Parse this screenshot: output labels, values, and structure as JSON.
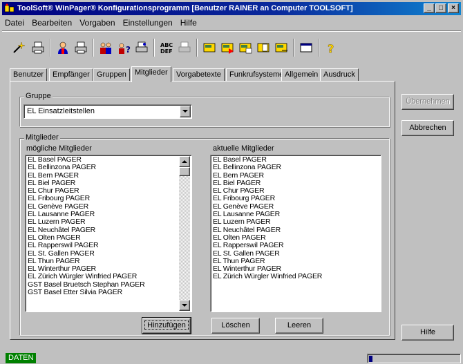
{
  "window": {
    "title": "ToolSoft® WinPager® Konfigurationsprogramm [Benutzer RAINER an Computer TOOLSOFT]",
    "controls": [
      "_",
      "□",
      "×"
    ]
  },
  "menu": [
    "Datei",
    "Bearbeiten",
    "Vorgaben",
    "Einstellungen",
    "Hilfe"
  ],
  "toolbar": {
    "icons": [
      "wand-icon",
      "print-icon",
      "user-icon",
      "print-user-icon",
      "users-icon",
      "user-question-icon",
      "print-users-icon",
      "abc-def-icon",
      "print-text-icon",
      "pager-icon",
      "pager-red-icon",
      "pager-send-icon",
      "pager-open-icon",
      "pager-list-icon",
      "window-icon",
      "help-icon"
    ]
  },
  "tabs": [
    "Benutzer",
    "Empfänger",
    "Gruppen",
    "Mitglieder",
    "Vorgabetexte",
    "Funkrufsysteme",
    "Allgemein",
    "Ausdruck"
  ],
  "active_tab": "Mitglieder",
  "gruppe": {
    "label": "Gruppe",
    "selected": "EL Einsatzleitstellen"
  },
  "mitglieder": {
    "label": "Mitglieder",
    "possible_label": "mögliche Mitglieder",
    "current_label": "aktuelle Mitglieder",
    "possible": [
      "EL Basel PAGER",
      "EL Bellinzona PAGER",
      "EL Bern PAGER",
      "EL Biel PAGER",
      "EL Chur PAGER",
      "EL Fribourg PAGER",
      "EL Genève PAGER",
      "EL Lausanne PAGER",
      "EL Luzern PAGER",
      "EL Neuchâtel PAGER",
      "EL Olten PAGER",
      "EL Rapperswil PAGER",
      "EL St. Gallen PAGER",
      "EL Thun PAGER",
      "EL Winterthur PAGER",
      "EL Zürich Würgler Winfried PAGER",
      "GST Basel Bruetsch Stephan PAGER",
      "GST Basel Etter Silvia PAGER"
    ],
    "current": [
      "EL Basel PAGER",
      "EL Bellinzona PAGER",
      "EL Bern PAGER",
      "EL Biel PAGER",
      "EL Chur PAGER",
      "EL Fribourg PAGER",
      "EL Genève PAGER",
      "EL Lausanne PAGER",
      "EL Luzern PAGER",
      "EL Neuchâtel PAGER",
      "EL Olten PAGER",
      "EL Rapperswil PAGER",
      "EL St. Gallen PAGER",
      "EL Thun PAGER",
      "EL Winterthur PAGER",
      "EL Zürich Würgler Winfried PAGER"
    ]
  },
  "buttons": {
    "hinzufuegen": "Hinzufügen",
    "loeschen": "Löschen",
    "leeren": "Leeren",
    "uebernehmen": "Übernehmen",
    "abbrechen": "Abbrechen",
    "hilfe": "Hilfe"
  },
  "status": {
    "mode": "DATEN",
    "mode_color": "#008000",
    "progress_fraction": 0.04
  },
  "colors": {
    "titlebar": "#000080",
    "face": "#c0c0c0"
  }
}
